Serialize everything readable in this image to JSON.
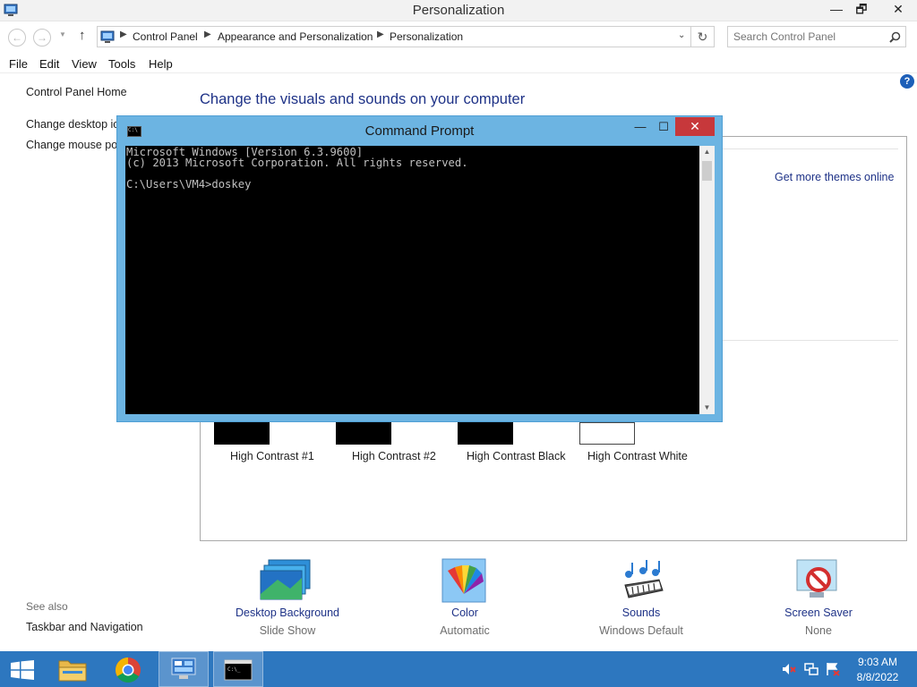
{
  "window": {
    "title": "Personalization",
    "min_label": "—",
    "max_label": "🗗",
    "close_label": "✕"
  },
  "nav": {
    "back_label": "←",
    "forward_label": "→",
    "up_label": "↑",
    "breadcrumbs": [
      "Control Panel",
      "Appearance and Personalization",
      "Personalization"
    ],
    "search_placeholder": "Search Control Panel"
  },
  "menu": [
    "File",
    "Edit",
    "View",
    "Tools",
    "Help"
  ],
  "left_pane": {
    "home": "Control Panel Home",
    "links": [
      "Change desktop ico",
      "Change mouse poi"
    ],
    "see_also_label": "See also",
    "see_also_links": [
      "Taskbar and Navigation"
    ]
  },
  "main": {
    "heading": "Change the visuals and sounds on your computer",
    "get_more": "Get more themes online",
    "themes": [
      "High Contrast #1",
      "High Contrast #2",
      "High Contrast Black",
      "High Contrast White"
    ],
    "options": [
      {
        "label": "Desktop Background",
        "value": "Slide Show",
        "icon": "desktop-background-icon"
      },
      {
        "label": "Color",
        "value": "Automatic",
        "icon": "color-icon"
      },
      {
        "label": "Sounds",
        "value": "Windows Default",
        "icon": "sounds-icon"
      },
      {
        "label": "Screen Saver",
        "value": "None",
        "icon": "screen-saver-icon"
      }
    ]
  },
  "cmd": {
    "title": "Command Prompt",
    "icon_text": "C:\\",
    "lines": [
      "Microsoft Windows [Version 6.3.9600]",
      "(c) 2013 Microsoft Corporation. All rights reserved.",
      "",
      "C:\\Users\\VM4>doskey"
    ]
  },
  "taskbar": {
    "time": "9:03 AM",
    "date": "8/8/2022",
    "apps": [
      "start-button",
      "file-explorer",
      "chrome",
      "control-panel",
      "command-prompt"
    ]
  },
  "colors": {
    "accent_link": "#1e3287",
    "taskbar": "#2d77bf",
    "cmd_frame": "#6cb4e2",
    "close_red": "#c7383b"
  }
}
